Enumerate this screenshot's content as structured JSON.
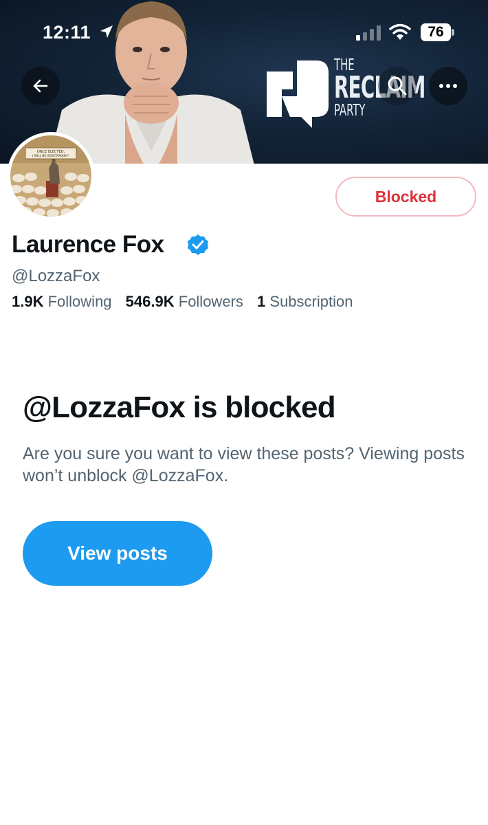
{
  "status_bar": {
    "time": "12:11",
    "battery": "76"
  },
  "banner": {
    "logo": {
      "line1": "THE",
      "line2": "RECLAIM",
      "line3": "PARTY"
    }
  },
  "header_actions": {
    "back_icon": "arrow-left-icon",
    "search_icon": "search-icon",
    "more_icon": "more-dots-icon"
  },
  "avatar": {
    "sign_text": "ONCE ELECTED, I WILL BE VEGETARIAN!!!"
  },
  "profile": {
    "display_name": "Laurence Fox",
    "handle": "@LozzaFox",
    "blocked_button": "Blocked",
    "stats": {
      "following_count": "1.9K",
      "following_label": "Following",
      "followers_count": "546.9K",
      "followers_label": "Followers",
      "subscription_count": "1",
      "subscription_label": "Subscription"
    }
  },
  "blocked_notice": {
    "title": "@LozzaFox is blocked",
    "description": "Are you sure you want to view these posts? Viewing posts won’t unblock @LozzaFox.",
    "button": "View posts"
  },
  "colors": {
    "accent": "#1d9bf0",
    "blocked_red": "#e0303a",
    "secondary_text": "#536471",
    "primary_text": "#0f1419",
    "banner_bg": "#132438"
  }
}
